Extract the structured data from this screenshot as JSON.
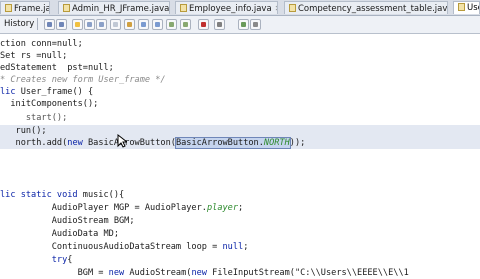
{
  "tabs": [
    {
      "label": "Frame.java",
      "active": false
    },
    {
      "label": "Admin_HR_JFrame.java",
      "active": false
    },
    {
      "label": "Employee_info.java",
      "active": false
    },
    {
      "label": "Competency_assessment_table.java",
      "active": false
    },
    {
      "label": "User",
      "active": true
    }
  ],
  "toolbar": {
    "history_label": "History",
    "buttons": [
      "back-icon",
      "forward-icon",
      "search-icon",
      "prev-icon",
      "next-icon",
      "toggle-icon",
      "bookmark-icon",
      "shift-left-icon",
      "shift-right-icon",
      "comment-icon",
      "uncomment-icon",
      "record-icon",
      "stop-icon",
      "play-icon",
      "diff-icon"
    ]
  },
  "code": {
    "l1": "ction conn=null;",
    "l2": "Set rs =null;",
    "l3": "edStatement  pst=null;",
    "l4": "* Creates new form User_frame */",
    "l5a": "lic",
    "l5b": " User_frame() {",
    "l6": "  initComponents();",
    "l7": "     start();",
    "l8": "   run();",
    "l9a": "   north.add(",
    "l9b": "new",
    "l9c": " BasicArrowButton(",
    "l9d": "BasicArrowButton.",
    "l9e": "NORTH",
    "l9f": "));",
    "l10a": "lic static void",
    "l10b": " music(){",
    "l11a": "          AudioPlayer MGP = AudioPlayer.",
    "l11b": "player",
    "l11c": ";",
    "l12": "          AudioStream BGM;",
    "l13": "          AudioData MD;",
    "l14a": "          ContinuousAudioDataStream loop = ",
    "l14b": "null",
    "l14c": ";",
    "l15a": "          ",
    "l15b": "try",
    "l15c": "{",
    "l16a": "               BGM = ",
    "l16b": "new",
    "l16c": " AudioStream(",
    "l16d": "new",
    "l16e": " FileInputStream(\"C:\\\\Users\\\\EEEE\\\\E\\\\1"
  },
  "colors": {
    "keyword": "#0b24a8",
    "comment": "#8a8a8a",
    "field": "#2e8b2e",
    "current_line": "#e3e8f2"
  }
}
